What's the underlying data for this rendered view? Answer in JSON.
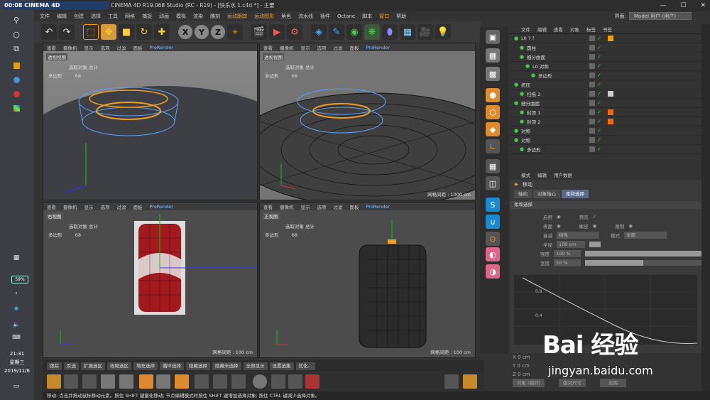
{
  "taskbar": {
    "search_label": "搜索",
    "battery": "59%",
    "time": "21:31",
    "weekday": "星期三",
    "date": "2019/11/6"
  },
  "window": {
    "title": "CINEMA 4D R19.068 Studio (RC - R19) - [快乐水 1.c4d *] - 主要",
    "search_overlay": "00:08 CINEMA 4D"
  },
  "menu": [
    "文件",
    "编辑",
    "创建",
    "选择",
    "工具",
    "网格",
    "捕捉",
    "动画",
    "模拟",
    "渲染",
    "雕刻",
    "运动跟踪",
    "运动图形",
    "角色",
    "流水线",
    "插件",
    "Octane",
    "脚本",
    "窗口",
    "帮助"
  ],
  "menu_highlight": [
    "运动跟踪",
    "运动图形",
    "窗口"
  ],
  "layout": {
    "label": "界面:",
    "value": "Model 用户 (用户)"
  },
  "toolbar": {
    "x": "X",
    "y": "Y",
    "z": "Z"
  },
  "viewport_menu": [
    "查看",
    "摄像机",
    "显示",
    "选项",
    "过滤",
    "面板",
    "ProRender"
  ],
  "viewports": [
    {
      "name": "透视视图",
      "info_hdr": "选取对象 总计",
      "poly_label": "多边形",
      "poly": "68",
      "foot": ""
    },
    {
      "name": "透视视图",
      "info_hdr": "选取对象 总计",
      "poly_label": "多边形",
      "poly": "68",
      "foot": "网格间距 : 1000 cm"
    },
    {
      "name": "右视图",
      "info_hdr": "选取对象 总计",
      "poly_label": "多边形",
      "poly": "68",
      "foot": "网格间距 : 100 cm"
    },
    {
      "name": "正视图",
      "info_hdr": "选取对象 总计",
      "poly_label": "多边形",
      "poly": "68",
      "foot": "网格间距 : 100 cm"
    }
  ],
  "viewport0_foot": "网格间距 : 1000 cm",
  "timeline_buttons": [
    "跟踪",
    "反选",
    "扩展选区",
    "收缩选区",
    "填充选择",
    "循环选择",
    "隐藏选择",
    "隐藏未选择",
    "全部显示",
    "设置选集",
    "优化..."
  ],
  "status": "移动: 点击并拖动鼠标移动元素。按住 SHIFT 键量化移动; 节点编辑模式时按住 SHIFT 键增加选择对象; 按住 CTRL 键减少选择对象。",
  "object_manager": {
    "menu": [
      "文件",
      "编辑",
      "查看",
      "对象",
      "标签",
      "书签"
    ],
    "rows": [
      {
        "name": "L0 ? ?",
        "indent": 0
      },
      {
        "name": "圆柱",
        "indent": 1
      },
      {
        "name": "细分曲面",
        "indent": 1
      },
      {
        "name": "L0 对称",
        "indent": 2
      },
      {
        "name": "多边形",
        "indent": 3
      },
      {
        "name": "挤压",
        "indent": 0
      },
      {
        "name": "扫描 2",
        "indent": 1
      },
      {
        "name": "细分曲面",
        "indent": 0
      },
      {
        "name": "封顶 1",
        "indent": 1
      },
      {
        "name": "封顶 2",
        "indent": 1
      },
      {
        "name": "对称",
        "indent": 0
      },
      {
        "name": "对称",
        "indent": 0
      },
      {
        "name": "多边形",
        "indent": 1
      }
    ]
  },
  "attributes": {
    "menu": [
      "模式",
      "编辑",
      "用户数据"
    ],
    "title": "移动",
    "tabs": [
      "轴向",
      "对象轴心",
      "柔和选择"
    ],
    "active_tab": "柔和选择",
    "section": "柔和选择",
    "rows": [
      {
        "label": "启用",
        "value": ""
      },
      {
        "label": "表面",
        "value": ""
      },
      {
        "label": "衰减",
        "value": "线性"
      },
      {
        "label": "半径",
        "value": "100 cm"
      },
      {
        "label": "强度",
        "value": "100 %"
      },
      {
        "label": "宽度",
        "value": "50 %"
      }
    ],
    "options": {
      "preview": "预览",
      "rubber": "橡皮",
      "restrict": "限制",
      "mode_label": "模式",
      "mode_value": "全部"
    },
    "strength_fill": 1.0,
    "width_fill": 0.5,
    "graph_ticks": [
      "0.8",
      "0.4"
    ]
  },
  "coords": {
    "x": "X 0 cm",
    "y": "Y 0 cm",
    "z": "Z 0 cm",
    "dropdown": "对象 (相对)",
    "dropdown2": "绝对尺寸",
    "apply": "应用"
  },
  "watermark": {
    "logo": "Bai 经验",
    "url": "jingyan.baidu.com"
  }
}
